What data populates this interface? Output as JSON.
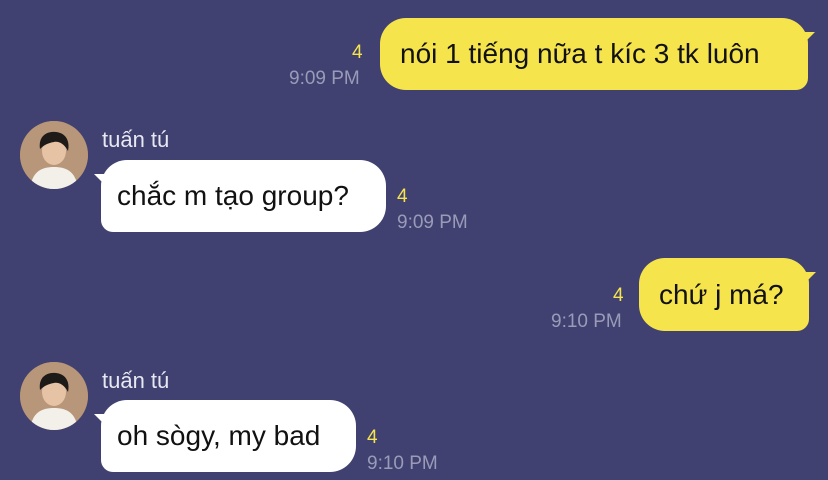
{
  "chat": {
    "accent": "#f6e44d",
    "background": "#404170",
    "messages": [
      {
        "direction": "outgoing",
        "text": "nói 1 tiếng nữa t kíc 3 tk luôn",
        "unread": "4",
        "time": "9:09 PM"
      },
      {
        "direction": "incoming",
        "sender": "tuấn tú",
        "avatar_icon": "user-avatar-photo",
        "text": "chắc m tạo group?",
        "unread": "4",
        "time": "9:09 PM"
      },
      {
        "direction": "outgoing",
        "text": "chứ j má?",
        "unread": "4",
        "time": "9:10 PM"
      },
      {
        "direction": "incoming",
        "sender": "tuấn tú",
        "avatar_icon": "user-avatar-photo",
        "text": "oh sògy, my bad",
        "unread": "4",
        "time": "9:10 PM"
      }
    ]
  }
}
